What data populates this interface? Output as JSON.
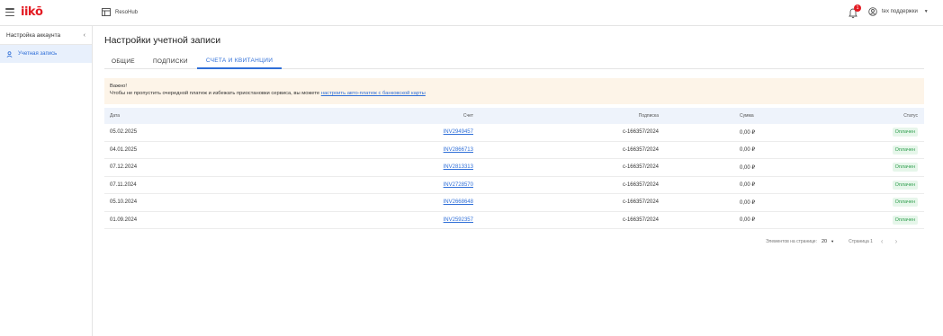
{
  "header": {
    "logo": "iikō",
    "app_name": "ResoHub",
    "notification_count": "1",
    "user_name": "tex поддержки"
  },
  "sidebar": {
    "title": "Настройка аккаунта",
    "items": [
      {
        "label": "Учетная запись",
        "icon": "user-icon",
        "active": true
      }
    ]
  },
  "main": {
    "title": "Настройки учетной записи",
    "tabs": [
      {
        "label": "ОБЩИЕ",
        "active": false
      },
      {
        "label": "ПОДПИСКИ",
        "active": false
      },
      {
        "label": "СЧЕТА И КВИТАНЦИИ",
        "active": true
      }
    ],
    "notice": {
      "title": "Важно!",
      "text": "Чтобы не пропустить очередной платеж и избежать приостановки сервиса, вы можете ",
      "link": "настроить авто-платеж с банковской карты"
    },
    "table": {
      "columns": [
        "Дата",
        "Счет",
        "Подписка",
        "Сумма",
        "Статус"
      ],
      "rows": [
        {
          "date": "05.02.2025",
          "invoice": "INV2949457",
          "subscription": "c-166357/2024",
          "amount": "0,00 ₽",
          "status": "Оплачен"
        },
        {
          "date": "04.01.2025",
          "invoice": "INV2866713",
          "subscription": "c-166357/2024",
          "amount": "0,00 ₽",
          "status": "Оплачен"
        },
        {
          "date": "07.12.2024",
          "invoice": "INV2813313",
          "subscription": "c-166357/2024",
          "amount": "0,00 ₽",
          "status": "Оплачен"
        },
        {
          "date": "07.11.2024",
          "invoice": "INV2728570",
          "subscription": "c-166357/2024",
          "amount": "0,00 ₽",
          "status": "Оплачен"
        },
        {
          "date": "05.10.2024",
          "invoice": "INV2668648",
          "subscription": "c-166357/2024",
          "amount": "0,00 ₽",
          "status": "Оплачен"
        },
        {
          "date": "01.09.2024",
          "invoice": "INV2592357",
          "subscription": "c-166357/2024",
          "amount": "0,00 ₽",
          "status": "Оплачен"
        }
      ]
    },
    "pagination": {
      "per_page_label": "Элементов на странице:",
      "per_page_value": "20",
      "page_label": "Страница 1"
    }
  },
  "colors": {
    "accent": "#2f6fd8",
    "brand": "#e31b23",
    "status_paid": "#2e9e4d",
    "notice_bg": "#fdf4e8"
  }
}
